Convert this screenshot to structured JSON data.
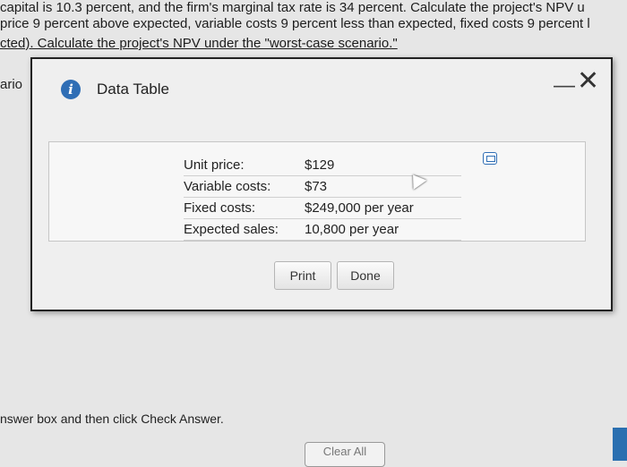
{
  "background": {
    "line1": "capital is 10.3 percent, and the firm's marginal tax rate is 34 percent. Calculate the project's NPV u",
    "line2": "price 9 percent above expected, variable costs 9 percent less than expected, fixed costs 9 percent l",
    "line3": "cted). Calculate the project's NPV under the \"worst-case scenario.\"",
    "left_fragment": "ario",
    "instruction": "nswer box and then click Check Answer.",
    "clear_button": "Clear All"
  },
  "dialog": {
    "title": "Data Table",
    "icons": {
      "info": "info-icon",
      "minimize": "minimize-icon",
      "close": "close-icon",
      "copy": "copy-icon"
    },
    "rows": [
      {
        "label": "Unit price:",
        "value": "$129"
      },
      {
        "label": "Variable costs:",
        "value": "$73"
      },
      {
        "label": "Fixed costs:",
        "value": "$249,000 per year"
      },
      {
        "label": "Expected sales:",
        "value": "10,800 per year"
      }
    ],
    "print_label": "Print",
    "done_label": "Done"
  },
  "colors": {
    "accent": "#2f6eb5"
  }
}
